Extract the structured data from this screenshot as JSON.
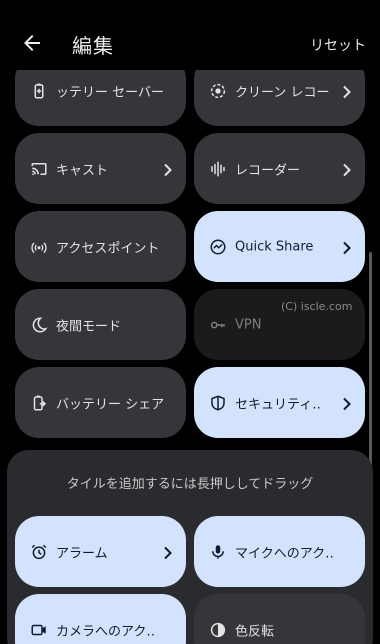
{
  "header": {
    "title": "編集",
    "reset_label": "リセット"
  },
  "active_tiles": [
    {
      "label": "ッテリー セーバー",
      "icon": "battery-saver-icon",
      "state": "off",
      "has_chevron": false
    },
    {
      "label": "クリーン レコー",
      "icon": "screen-record-icon",
      "state": "off",
      "has_chevron": true
    },
    {
      "label": "キャスト",
      "icon": "cast-icon",
      "state": "off",
      "has_chevron": true
    },
    {
      "label": "レコーダー",
      "icon": "recorder-icon",
      "state": "off",
      "has_chevron": true
    },
    {
      "label": "アクセスポイント",
      "icon": "hotspot-icon",
      "state": "off",
      "has_chevron": false
    },
    {
      "label": "Quick Share",
      "icon": "quick-share-icon",
      "state": "on",
      "has_chevron": true
    },
    {
      "label": "夜間モード",
      "icon": "moon-icon",
      "state": "off",
      "has_chevron": false
    },
    {
      "label": "VPN",
      "icon": "vpn-key-icon",
      "state": "unavailable",
      "has_chevron": false
    },
    {
      "label": "バッテリー シェア",
      "icon": "battery-share-icon",
      "state": "off",
      "has_chevron": false
    },
    {
      "label": "セキュリティ‥",
      "icon": "shield-icon",
      "state": "on",
      "has_chevron": true
    }
  ],
  "watermark": "(C) iscle.com",
  "add_sheet": {
    "hint": "タイルを追加するには長押ししてドラッグ",
    "tiles": [
      {
        "label": "アラーム",
        "icon": "alarm-icon",
        "state": "on",
        "has_chevron": true
      },
      {
        "label": "マイクへのアク‥",
        "icon": "mic-icon",
        "state": "on",
        "has_chevron": false
      },
      {
        "label": "カメラへのアク‥",
        "icon": "camera-icon",
        "state": "on",
        "has_chevron": false
      },
      {
        "label": "色反転",
        "icon": "invert-colors-icon",
        "state": "off",
        "has_chevron": false
      }
    ]
  }
}
